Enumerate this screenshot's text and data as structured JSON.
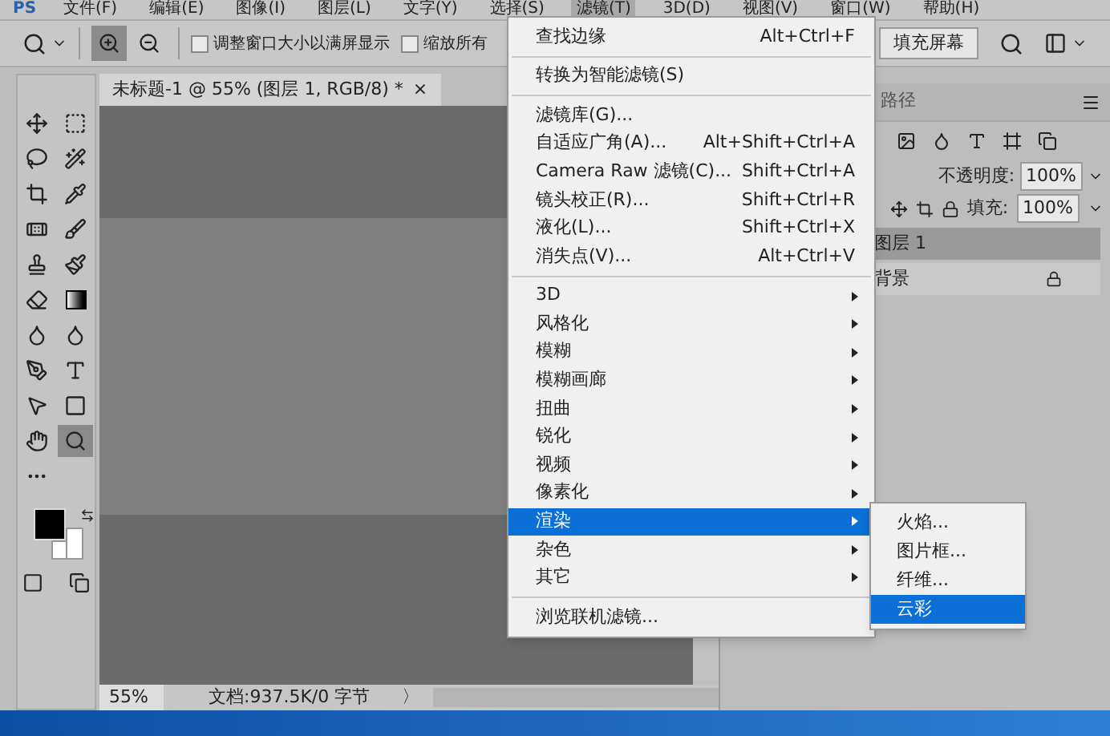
{
  "menu_bar": {
    "logo": "PS",
    "items": [
      {
        "label": "文件(F)",
        "selected": false
      },
      {
        "label": "编辑(E)",
        "selected": false
      },
      {
        "label": "图像(I)",
        "selected": false
      },
      {
        "label": "图层(L)",
        "selected": false
      },
      {
        "label": "文字(Y)",
        "selected": false
      },
      {
        "label": "选择(S)",
        "selected": false
      },
      {
        "label": "滤镜(T)",
        "selected": true
      },
      {
        "label": "3D(D)",
        "selected": false
      },
      {
        "label": "视图(V)",
        "selected": false
      },
      {
        "label": "窗口(W)",
        "selected": false
      },
      {
        "label": "帮助(H)",
        "selected": false
      }
    ]
  },
  "options_bar": {
    "zoom_in_selected": true,
    "checkboxes": [
      {
        "label": "调整窗口大小以满屏显示",
        "checked": false
      },
      {
        "label": "缩放所有",
        "checked": false
      }
    ],
    "fill_screen_button": "填充屏幕"
  },
  "toolbox": {
    "tools": [
      {
        "kind": "move",
        "selected": false
      },
      {
        "kind": "marquee",
        "selected": false
      },
      {
        "kind": "lasso",
        "selected": false
      },
      {
        "kind": "wand",
        "selected": false
      },
      {
        "kind": "crop",
        "selected": false
      },
      {
        "kind": "eyedropper",
        "selected": false
      },
      {
        "kind": "healing",
        "selected": false
      },
      {
        "kind": "brush",
        "selected": false
      },
      {
        "kind": "stamp",
        "selected": false
      },
      {
        "kind": "history-brush",
        "selected": false
      },
      {
        "kind": "eraser",
        "selected": false
      },
      {
        "kind": "gradient",
        "selected": false
      },
      {
        "kind": "blur",
        "selected": false
      },
      {
        "kind": "dodge",
        "selected": false
      },
      {
        "kind": "pen",
        "selected": false
      },
      {
        "kind": "type",
        "selected": false
      },
      {
        "kind": "select",
        "selected": false
      },
      {
        "kind": "shape",
        "selected": false
      },
      {
        "kind": "hand",
        "selected": false
      },
      {
        "kind": "zoom",
        "selected": true
      },
      {
        "kind": "more",
        "selected": false
      }
    ]
  },
  "document": {
    "tab_title": "未标题-1 @ 55% (图层 1, RGB/8) *",
    "tab_close": "×",
    "zoom": "55%",
    "doc_info": "文档:937.5K/0 字节",
    "status_arrow": "〉"
  },
  "layers_panel": {
    "tab": "路径",
    "opacity_label": "不透明度:",
    "opacity": "100%",
    "fill_label": "填充:",
    "fill": "100%",
    "layers": [
      {
        "name": "图层 1",
        "selected": true,
        "locked": false
      },
      {
        "name": "背景",
        "selected": false,
        "locked": true
      }
    ]
  },
  "filter_menu": {
    "items": [
      {
        "kind": "item",
        "label": "查找边缘",
        "shortcut": "Alt+Ctrl+F",
        "submenu": false,
        "selected": false
      },
      {
        "kind": "separator"
      },
      {
        "kind": "item",
        "label": "转换为智能滤镜(S)",
        "submenu": false,
        "selected": false
      },
      {
        "kind": "separator"
      },
      {
        "kind": "item",
        "label": "滤镜库(G)...",
        "submenu": false,
        "selected": false
      },
      {
        "kind": "item",
        "label": "自适应广角(A)...",
        "shortcut": "Alt+Shift+Ctrl+A",
        "submenu": false,
        "selected": false
      },
      {
        "kind": "item",
        "label": "Camera Raw 滤镜(C)...",
        "shortcut": "Shift+Ctrl+A",
        "submenu": false,
        "selected": false
      },
      {
        "kind": "item",
        "label": "镜头校正(R)...",
        "shortcut": "Shift+Ctrl+R",
        "submenu": false,
        "selected": false
      },
      {
        "kind": "item",
        "label": "液化(L)...",
        "shortcut": "Shift+Ctrl+X",
        "submenu": false,
        "selected": false
      },
      {
        "kind": "item",
        "label": "消失点(V)...",
        "shortcut": "Alt+Ctrl+V",
        "submenu": false,
        "selected": false
      },
      {
        "kind": "separator"
      },
      {
        "kind": "item",
        "label": "3D",
        "submenu": true,
        "selected": false
      },
      {
        "kind": "item",
        "label": "风格化",
        "submenu": true,
        "selected": false
      },
      {
        "kind": "item",
        "label": "模糊",
        "submenu": true,
        "selected": false
      },
      {
        "kind": "item",
        "label": "模糊画廊",
        "submenu": true,
        "selected": false
      },
      {
        "kind": "item",
        "label": "扭曲",
        "submenu": true,
        "selected": false
      },
      {
        "kind": "item",
        "label": "锐化",
        "submenu": true,
        "selected": false
      },
      {
        "kind": "item",
        "label": "视频",
        "submenu": true,
        "selected": false
      },
      {
        "kind": "item",
        "label": "像素化",
        "submenu": true,
        "selected": false
      },
      {
        "kind": "item",
        "label": "渲染",
        "submenu": true,
        "selected": true
      },
      {
        "kind": "item",
        "label": "杂色",
        "submenu": true,
        "selected": false
      },
      {
        "kind": "item",
        "label": "其它",
        "submenu": true,
        "selected": false
      },
      {
        "kind": "separator"
      },
      {
        "kind": "item",
        "label": "浏览联机滤镜...",
        "submenu": false,
        "selected": false
      }
    ]
  },
  "render_submenu": {
    "items": [
      {
        "label": "火焰...",
        "selected": false
      },
      {
        "label": "图片框...",
        "selected": false
      },
      {
        "label": "纤维...",
        "selected": false
      },
      {
        "label": "云彩",
        "selected": true
      }
    ]
  }
}
